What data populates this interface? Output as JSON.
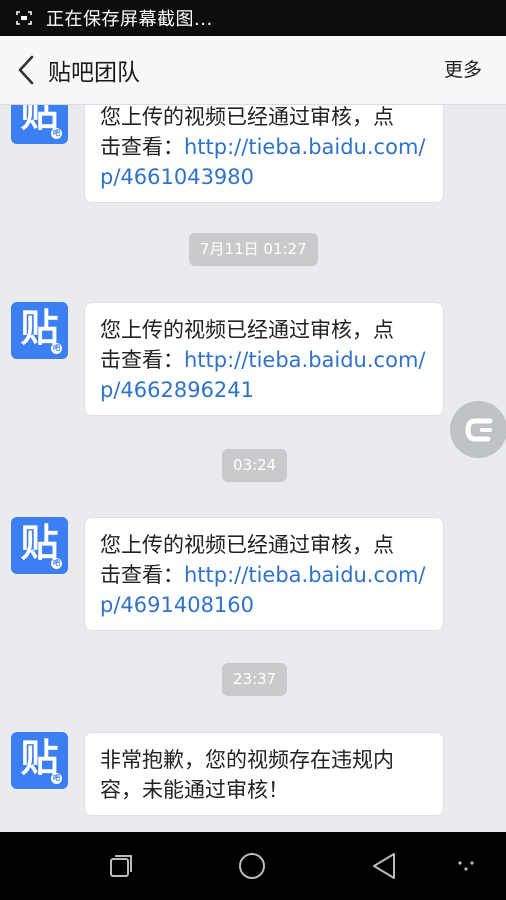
{
  "status_bar": {
    "text": "正在保存屏幕截图..."
  },
  "header": {
    "title": "贴吧团队",
    "more_label": "更多"
  },
  "avatar": {
    "glyph": "贴",
    "badge": "吧"
  },
  "messages": [
    {
      "line1": "您上传的视频已经通过审核，点",
      "line2_prefix": "击查看：",
      "line2_link": "http://tieba.baidu.com/",
      "line3_link": "p/4661043980"
    },
    {
      "line1": "您上传的视频已经通过审核，点",
      "line2_prefix": "击查看：",
      "line2_link": "http://tieba.baidu.com/",
      "line3_link": "p/4662896241"
    },
    {
      "line1": "您上传的视频已经通过审核，点",
      "line2_prefix": "击查看：",
      "line2_link": "http://tieba.baidu.com/",
      "line3_link": "p/4691408160"
    },
    {
      "line1": "非常抱歉，您的视频存在违规内",
      "line2": "容，未能通过审核！"
    }
  ],
  "timestamps": [
    "7月11日 01:27",
    "03:24",
    "23:37"
  ],
  "colors": {
    "accent": "#3b7ff2",
    "link": "#2f73c9",
    "background": "#e9ebee"
  },
  "icons": {
    "status": "screenshot-icon",
    "back": "chevron-left-icon",
    "float": "c-logo-icon",
    "nav": [
      "recent-apps-icon",
      "home-icon",
      "back-triangle-icon",
      "menu-dots-icon"
    ]
  }
}
